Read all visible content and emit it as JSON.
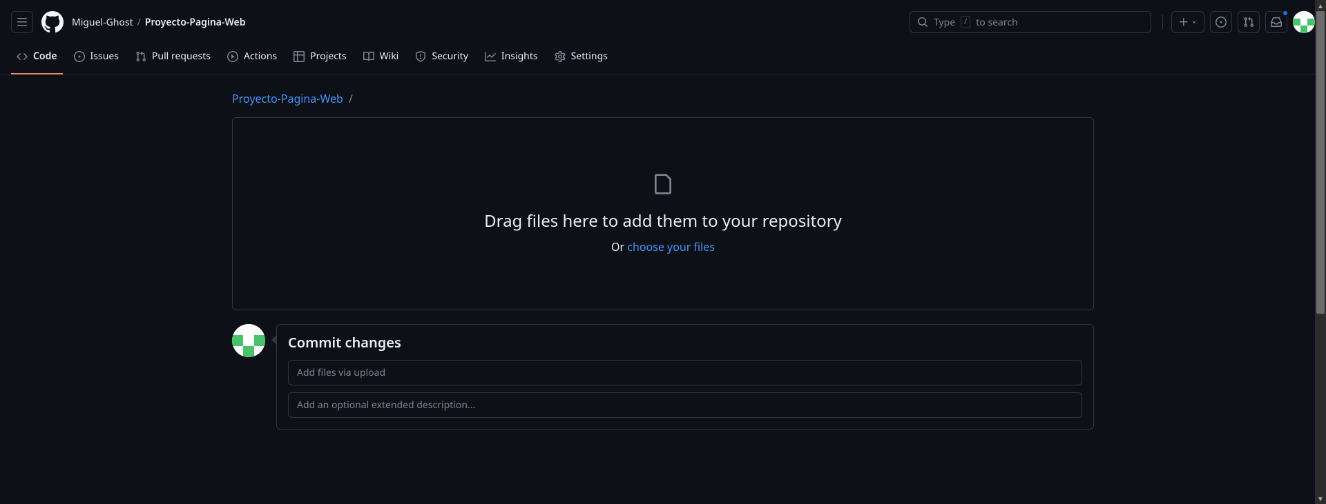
{
  "header": {
    "owner": "Miguel-Ghost",
    "separator": "/",
    "repo": "Proyecto-Pagina-Web",
    "search": {
      "prefix": "Type",
      "key": "/",
      "suffix": "to search"
    }
  },
  "nav": {
    "tabs": [
      {
        "label": "Code",
        "active": true
      },
      {
        "label": "Issues",
        "active": false
      },
      {
        "label": "Pull requests",
        "active": false
      },
      {
        "label": "Actions",
        "active": false
      },
      {
        "label": "Projects",
        "active": false
      },
      {
        "label": "Wiki",
        "active": false
      },
      {
        "label": "Security",
        "active": false
      },
      {
        "label": "Insights",
        "active": false
      },
      {
        "label": "Settings",
        "active": false
      }
    ]
  },
  "path": {
    "repo": "Proyecto-Pagina-Web",
    "separator": "/"
  },
  "dropzone": {
    "headline": "Drag files here to add them to your repository",
    "or_text": "Or ",
    "choose_link": "choose your files"
  },
  "commit": {
    "title": "Commit changes",
    "summary_placeholder": "Add files via upload",
    "description_placeholder": "Add an optional extended description..."
  }
}
